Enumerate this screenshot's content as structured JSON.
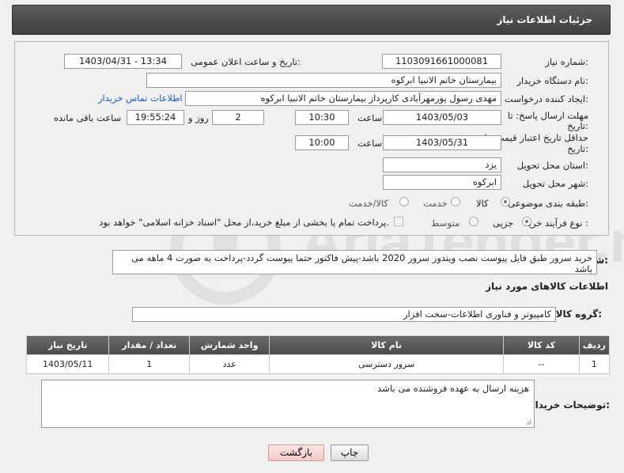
{
  "header": {
    "title": "جزئیات اطلاعات نیاز"
  },
  "fields": {
    "need_number": {
      "label": "شماره نیاز:",
      "value": "1103091661000081"
    },
    "announce": {
      "label": "تاریخ و ساعت اعلان عمومی:",
      "value": "1403/04/31 - 13:34"
    },
    "buyer_org": {
      "label": "نام دستگاه خریدار:",
      "value": "بیمارستان خاتم الانبیا ابرکوه"
    },
    "creator": {
      "label": "ایجاد کننده درخواست:",
      "value": "مهدی رسول پورمهرآبادی کارپرداز بیمارستان خاتم الانبیا ابرکوه",
      "contact_link": "اطلاعات تماس خریدار"
    },
    "reply_deadline": {
      "label_line1": "مهلت ارسال پاسخ: تا",
      "label_line2": "تاریخ:",
      "date": "1403/05/03",
      "time_label": "ساعت",
      "time": "10:30",
      "days": "2",
      "days_label": "روز و",
      "remaining": "19:55:24",
      "remaining_label": "ساعت باقی مانده"
    },
    "price_validity": {
      "label_line1": "حداقل تاریخ اعتبار قیمت: تا",
      "label_line2": "تاریخ:",
      "date": "1403/05/31",
      "time_label": "ساعت",
      "time": "10:00"
    },
    "province": {
      "label": "استان محل تحویل:",
      "value": "یزد"
    },
    "city": {
      "label": "شهر محل تحویل:",
      "value": "ابرکوه"
    },
    "category": {
      "label": "طبقه بندی موضوعی:",
      "options": [
        "کالا",
        "خدمت",
        "کالا/خدمت"
      ],
      "selected": "کالا"
    },
    "purchase_type": {
      "label": "نوع فرآیند خرید :",
      "options": [
        "جزیی",
        "متوسط"
      ],
      "selected": "جزیی",
      "payment_note": "پرداخت تمام یا بخشی از مبلغ خرید،از محل \"اسناد خزانه اسلامی\" خواهد بود."
    }
  },
  "summary": {
    "label": "شرح کلی نیاز:",
    "value": "خرید سرور طبق فایل پیوست نصب ویندوز سرور 2020 باشد-پیش فاکتور حتما پیوست گردد-پرداخت به صورت 4 ماهه می باشد"
  },
  "goods_section": {
    "title": "اطلاعات کالاهای مورد نیاز"
  },
  "goods_group": {
    "label": "گروه کالا:",
    "value": "کامپیوتر و فناوری اطلاعات-سخت افزار"
  },
  "table": {
    "headers": [
      "ردیف",
      "کد کالا",
      "نام کالا",
      "واحد شمارش",
      "تعداد / مقدار",
      "تاریخ نیاز"
    ],
    "rows": [
      [
        "1",
        "--",
        "سرور دسترسی",
        "عدد",
        "1",
        "1403/05/11"
      ]
    ]
  },
  "buyer_notes": {
    "label": "توضیحات خریدار:",
    "value": "هزینه ارسال به عهده فروشنده می باشد"
  },
  "buttons": {
    "print": "چاپ",
    "back": "بازگشت"
  },
  "watermark": {
    "text": "AriaTender.neT"
  }
}
